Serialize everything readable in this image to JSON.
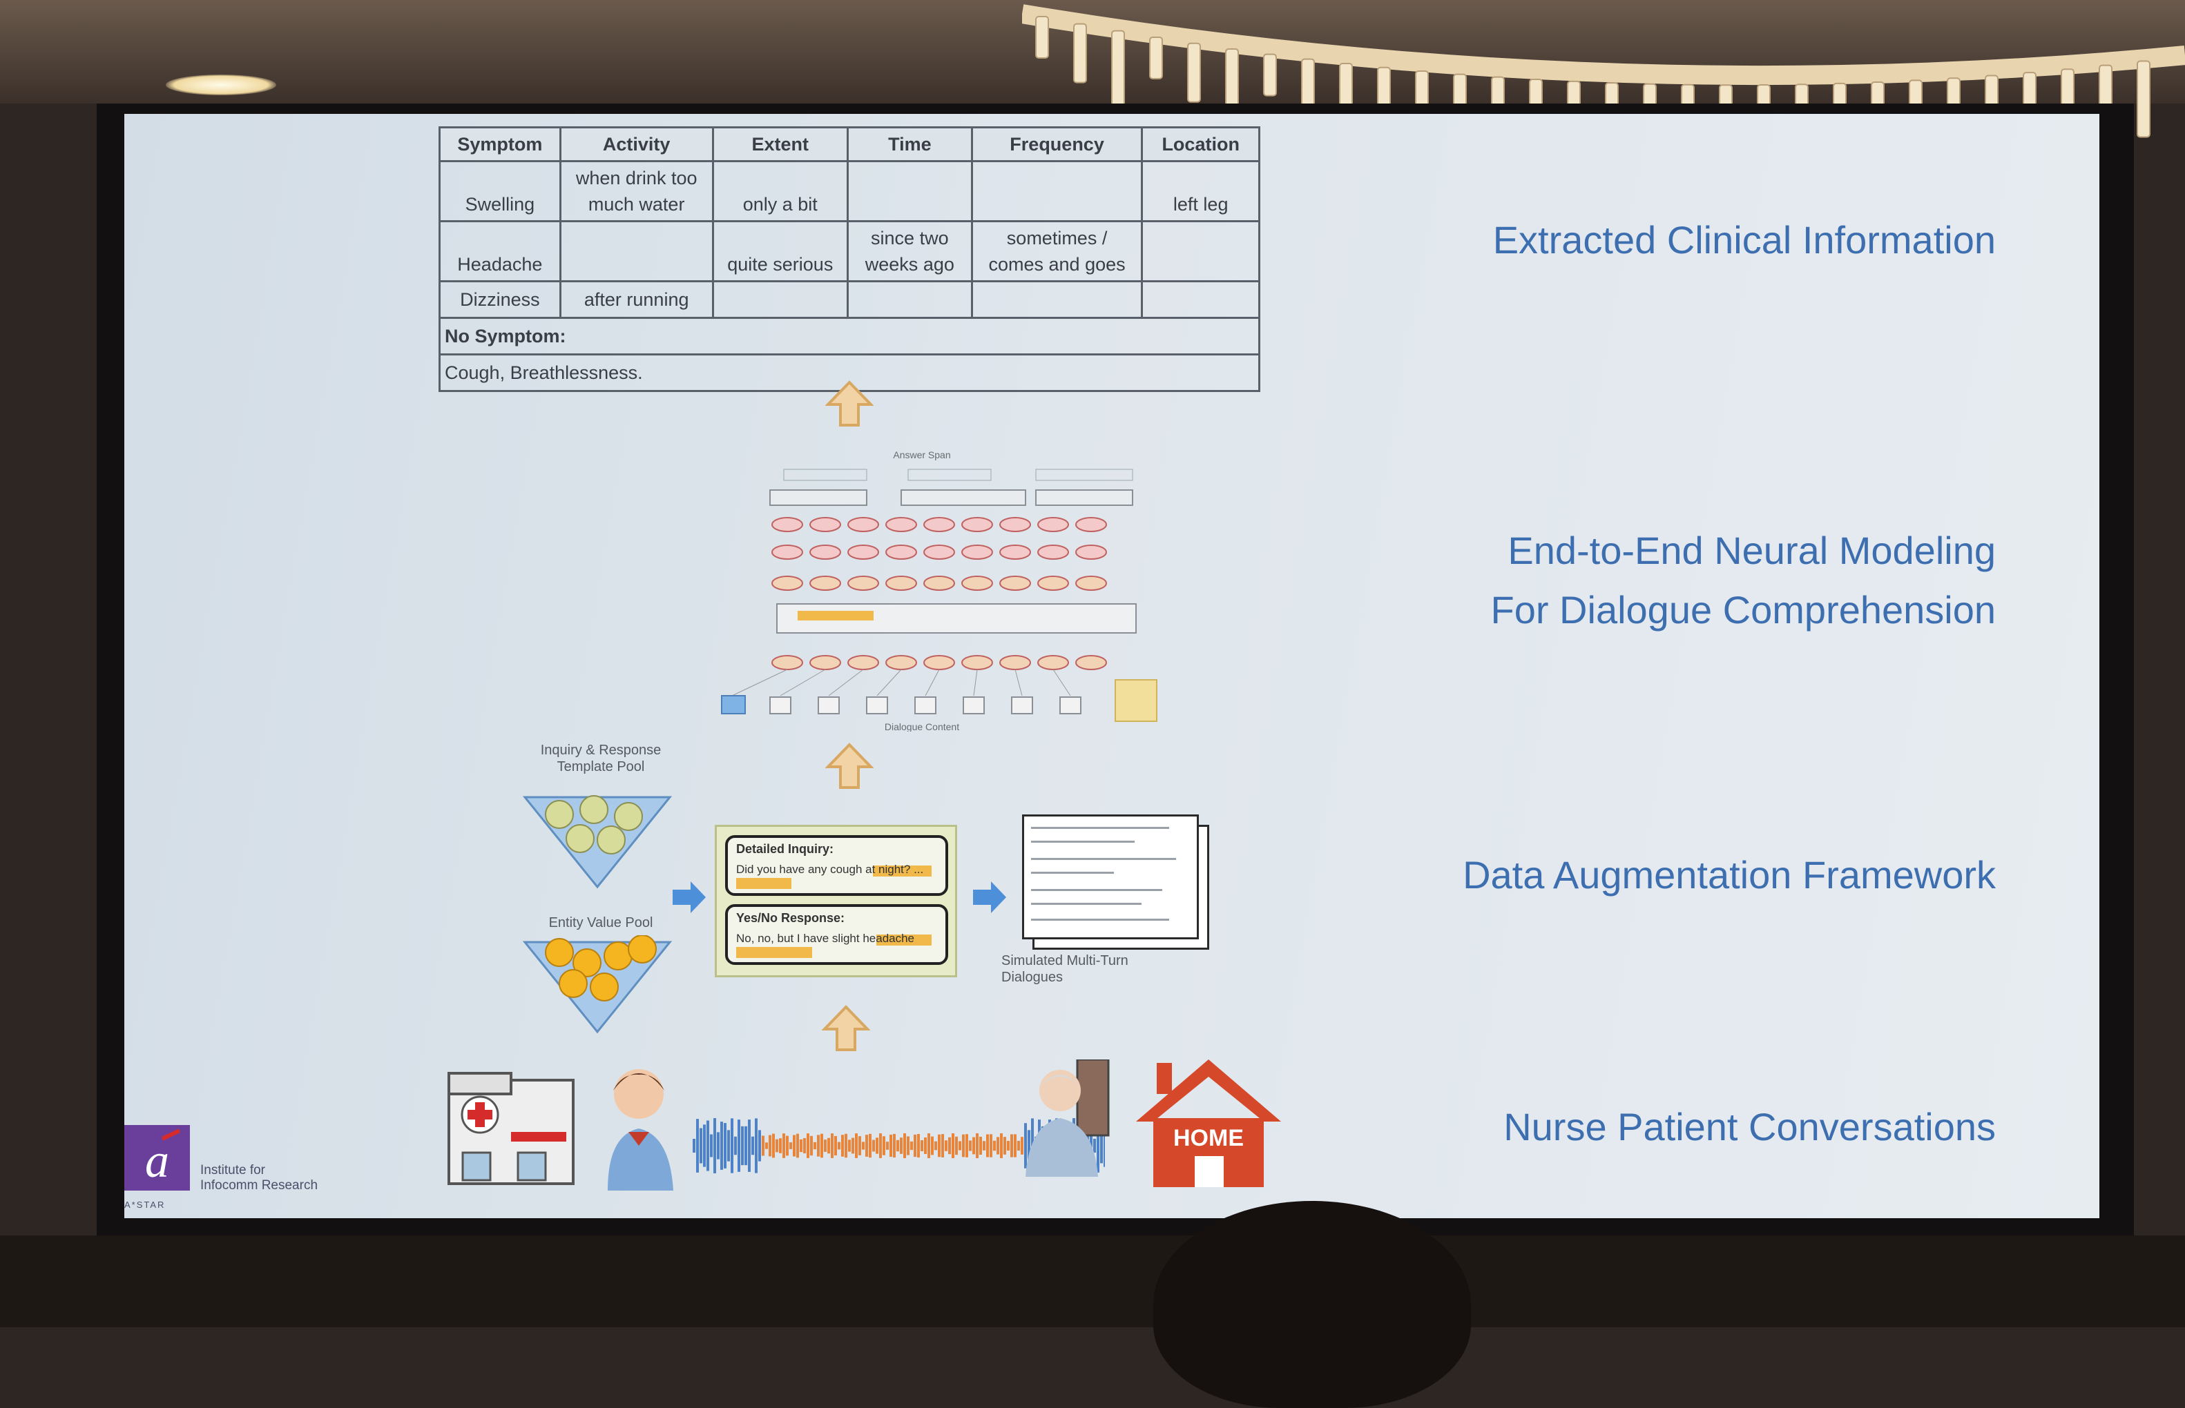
{
  "table": {
    "headers": [
      "Symptom",
      "Activity",
      "Extent",
      "Time",
      "Frequency",
      "Location"
    ],
    "rows": [
      [
        "Swelling",
        "when drink too much water",
        "only a bit",
        "",
        "",
        "left leg"
      ],
      [
        "Headache",
        "",
        "quite serious",
        "since two weeks ago",
        "sometimes / comes and goes",
        ""
      ],
      [
        "Dizziness",
        "after running",
        "",
        "",
        "",
        ""
      ]
    ],
    "no_symptom_label": "No Symptom:",
    "no_symptom_values": "Cough, Breathlessness."
  },
  "labels": {
    "extracted": "Extracted Clinical Information",
    "neural_line1": "End-to-End Neural Modeling",
    "neural_line2": "For Dialogue Comprehension",
    "augmentation": "Data Augmentation Framework",
    "conversations": "Nurse Patient Conversations"
  },
  "augmentation": {
    "template_pool": "Inquiry & Response Template Pool",
    "entity_pool": "Entity Value Pool",
    "inquiry_title": "Detailed Inquiry:",
    "inquiry_text": "Did you have any cough at night? ...",
    "response_title": "Yes/No Response:",
    "response_text": "No, no, but I have slight headache",
    "simulated": "Simulated Multi-Turn Dialogues"
  },
  "neural": {
    "encoded_state": "Answer Span",
    "bottom_label": "Dialogue Content"
  },
  "home_sign": "HOME",
  "logo": {
    "line1": "Institute for",
    "line2": "Infocomm Research",
    "brand": "A*STAR"
  },
  "colors": {
    "label_blue": "#3d6fb0",
    "home_red": "#d5482a",
    "highlight_orange": "#f0b94a",
    "arrow_blue": "#4d8fd8",
    "up_arrow": "#e9c08a"
  }
}
